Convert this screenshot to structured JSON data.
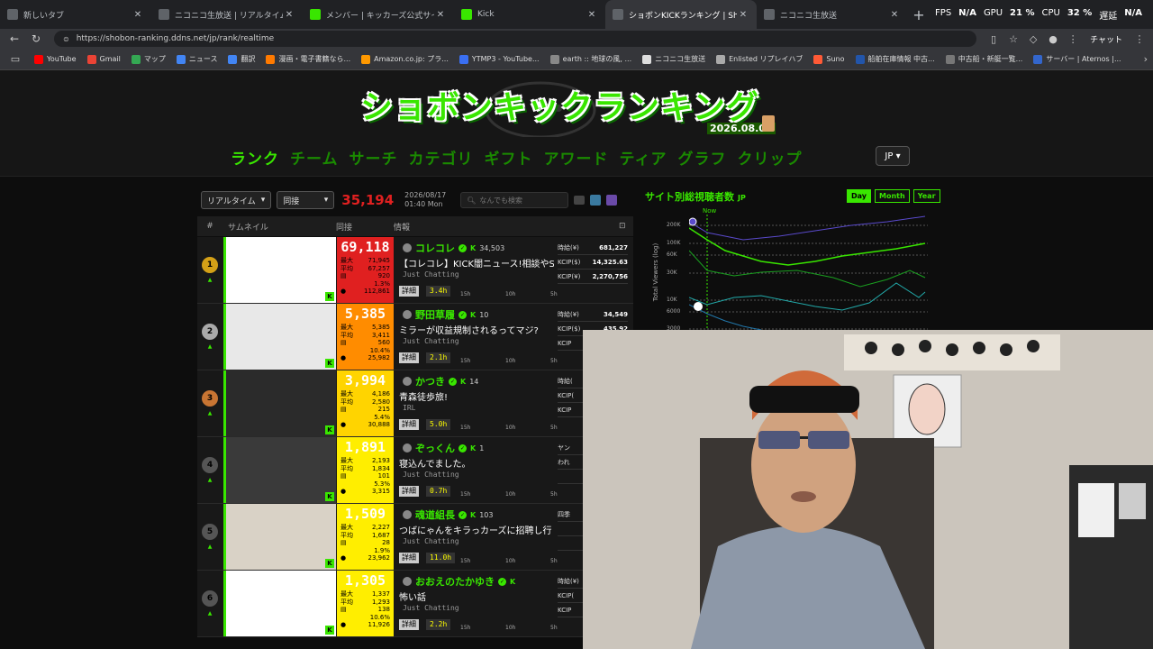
{
  "browser": {
    "tabs": [
      {
        "title": "新しいタブ",
        "icon_color": "#5f6368",
        "active": false
      },
      {
        "title": "ニコニコ生放送 | リアルタイムランキング",
        "icon_color": "#5f6368",
        "active": false
      },
      {
        "title": "メンバー | キッカーズ公式サイト",
        "icon_color": "#39e600",
        "active": false
      },
      {
        "title": "Kick",
        "icon_color": "#39e600",
        "active": false
      },
      {
        "title": "ショボンKICKランキング | Shobon Kick",
        "icon_color": "#5f6368",
        "active": true
      },
      {
        "title": "ニコニコ生放送",
        "icon_color": "#5f6368",
        "active": false
      }
    ],
    "new_tab_label": "+",
    "stats": {
      "fps_label": "FPS",
      "fps": "N/A",
      "gpu_label": "GPU",
      "gpu": "21 %",
      "cpu_label": "CPU",
      "cpu": "32 %",
      "lat_label": "遅延",
      "lat": "N/A"
    },
    "url": "https://shobon-ranking.ddns.net/jp/rank/realtime",
    "chat_label": "チャット",
    "bookmarks": [
      {
        "label": "YouTube",
        "color": "#ff0000"
      },
      {
        "label": "Gmail",
        "color": "#ea4335"
      },
      {
        "label": "マップ",
        "color": "#34a853"
      },
      {
        "label": "ニュース",
        "color": "#4285f4"
      },
      {
        "label": "翻訳",
        "color": "#4285f4"
      },
      {
        "label": "漫画・電子書籍なら...",
        "color": "#ff7a00"
      },
      {
        "label": "Amazon.co.jp: プラ...",
        "color": "#ff9900"
      },
      {
        "label": "YTMP3 - YouTube...",
        "color": "#3a6ff2"
      },
      {
        "label": "earth :: 地球の風, ...",
        "color": "#888888"
      },
      {
        "label": "ニコニコ生放送",
        "color": "#dddddd"
      },
      {
        "label": "Enlisted リプレイハブ",
        "color": "#aaaaaa"
      },
      {
        "label": "Suno",
        "color": "#ff5a36"
      },
      {
        "label": "船舶在庫情報 中古...",
        "color": "#2255aa"
      },
      {
        "label": "中古船・新艇一覧...",
        "color": "#777777"
      },
      {
        "label": "サーバー | Aternos |...",
        "color": "#3366cc"
      }
    ]
  },
  "site": {
    "logo": "ショボンキックランキング",
    "logo_date": "2026.08.02",
    "nav": [
      "ランク",
      "チーム",
      "サーチ",
      "カテゴリ",
      "ギフト",
      "アワード",
      "ティア",
      "グラフ",
      "クリップ"
    ],
    "lang": "JP ▾",
    "controls": {
      "mode": "リアルタイム",
      "metric": "同接",
      "total": "35,194",
      "date": "2026/08/17",
      "time": "01:40 Mon",
      "search_placeholder": "なんでも検索"
    },
    "table_headers": {
      "rank": "#",
      "thumb": "サムネイル",
      "viewers": "同接",
      "info": "情報"
    },
    "rows": [
      {
        "rank": "1",
        "rank_color": "#d4a017",
        "color": "#e02020",
        "viewers": "69,118",
        "max": "71,945",
        "avg": "67,257",
        "c1": "920",
        "pct": "1.3%",
        "total": "112,861",
        "channel": "コレコレ",
        "followers": "34,503",
        "title": "【コレコレ】KICK闇ニュース!相談やSNS",
        "category": "Just Chatting",
        "duration": "3.4h",
        "side": [
          [
            "時給(¥)",
            "681,227"
          ],
          [
            "KCIP($)",
            "14,325.63"
          ],
          [
            "KCIP(¥)",
            "2,270,756"
          ]
        ],
        "thumb_bg": "#ffffff"
      },
      {
        "rank": "2",
        "rank_color": "#aaaaaa",
        "color": "#ff8c00",
        "viewers": "5,385",
        "max": "5,385",
        "avg": "3,411",
        "c1": "560",
        "pct": "10.4%",
        "total": "25,982",
        "channel": "野田草履",
        "followers": "10",
        "title": "ミラーが収益規制されるってマジ?",
        "category": "Just Chatting",
        "duration": "2.1h",
        "side": [
          [
            "時給(¥)",
            "34,549"
          ],
          [
            "KCIP($)",
            "435.92"
          ],
          [
            "KCIP",
            ""
          ]
        ],
        "thumb_bg": "#e8e8e8"
      },
      {
        "rank": "3",
        "rank_color": "#c87533",
        "color": "#ffd400",
        "viewers": "3,994",
        "max": "4,186",
        "avg": "2,580",
        "c1": "215",
        "pct": "5.4%",
        "total": "30,888",
        "channel": "かつき",
        "followers": "14",
        "title": "青森徒歩旅!",
        "category": "IRL",
        "duration": "5.0h",
        "side": [
          [
            "時給(",
            ""
          ],
          [
            "KCIP(",
            ""
          ],
          [
            "KCIP",
            ""
          ]
        ],
        "thumb_bg": "#2b2b2b"
      },
      {
        "rank": "4",
        "rank_color": "#555555",
        "color": "#ffee00",
        "viewers": "1,891",
        "max": "2,193",
        "avg": "1,834",
        "c1": "101",
        "pct": "5.3%",
        "total": "3,315",
        "channel": "ぞっくん",
        "followers": "1",
        "title": "寝込んでました。",
        "category": "Just Chatting",
        "duration": "0.7h",
        "side": [
          [
            "ヤン",
            ""
          ],
          [
            "われ",
            ""
          ],
          [
            "",
            ""
          ]
        ],
        "thumb_bg": "#3a3a3a"
      },
      {
        "rank": "5",
        "rank_color": "#555555",
        "color": "#ffee00",
        "viewers": "1,509",
        "max": "2,227",
        "avg": "1,687",
        "c1": "28",
        "pct": "1.9%",
        "total": "23,962",
        "channel": "魂道組長",
        "followers": "103",
        "title": "つばにゃんをキラっカーズに招聘し行",
        "category": "Just Chatting",
        "duration": "11.0h",
        "side": [
          [
            "四季",
            ""
          ],
          [
            "",
            ""
          ],
          [
            "",
            ""
          ]
        ],
        "thumb_bg": "#d9d2c6"
      },
      {
        "rank": "6",
        "rank_color": "#555555",
        "color": "#ffee00",
        "viewers": "1,305",
        "max": "1,337",
        "avg": "1,293",
        "c1": "138",
        "pct": "10.6%",
        "total": "11,926",
        "channel": "おおえのたかゆき",
        "followers": "",
        "title": "怖い話",
        "category": "Just Chatting",
        "duration": "2.2h",
        "side": [
          [
            "時給(¥)",
            ""
          ],
          [
            "KCIP(",
            ""
          ],
          [
            "KCIP",
            ""
          ]
        ],
        "thumb_bg": "#ffffff"
      }
    ],
    "row_labels": {
      "max": "最大",
      "avg": "平均",
      "detail": "詳細",
      "t15": "15h",
      "t10": "10h",
      "t5": "5h"
    },
    "graph": {
      "title": "サイト別総視聴者数",
      "region": "JP",
      "buttons": [
        "Day",
        "Month",
        "Year"
      ],
      "now_label": "Now",
      "ylabel": "Total Viewers (log)",
      "yticks": [
        "200K",
        "100K",
        "60K",
        "30K",
        "10K",
        "6000",
        "3000"
      ]
    }
  },
  "colors": {
    "accent": "#39e600",
    "page_bg": "#0d0d0d"
  }
}
